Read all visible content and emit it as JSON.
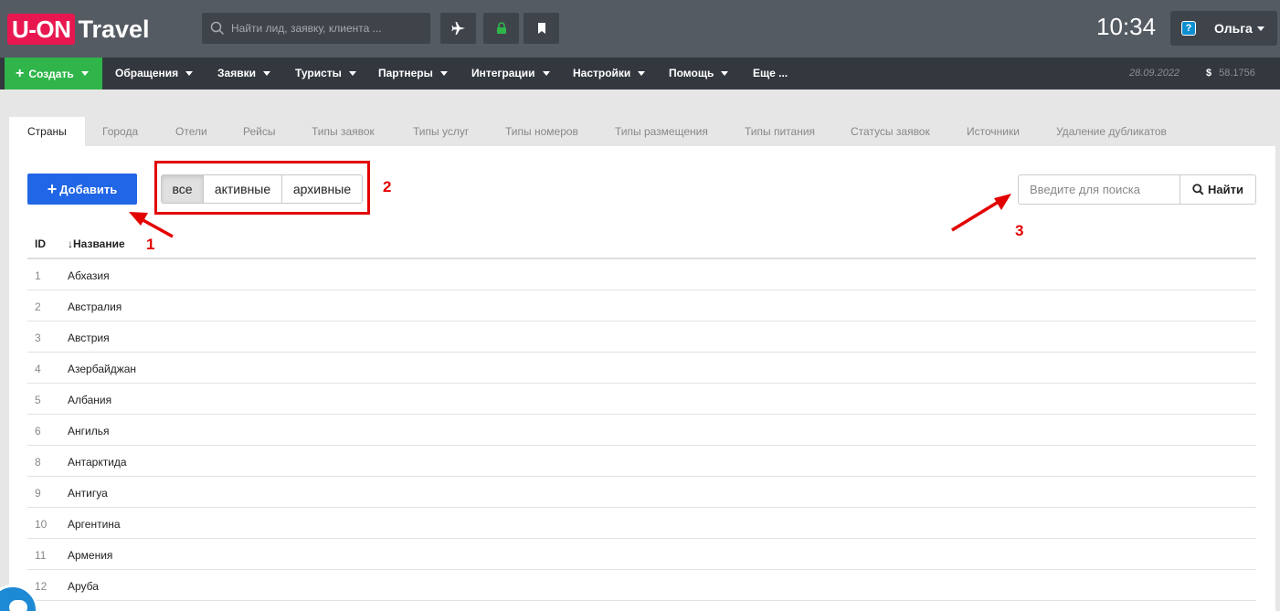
{
  "header": {
    "logo_box": "U-ON",
    "logo_text": "Travel",
    "search_placeholder": "Найти лид, заявку, клиента ...",
    "icons": [
      "plane-icon",
      "lock-icon",
      "bookmark-icon"
    ],
    "clock": "10:34",
    "user": "Ольга",
    "colors": {
      "logo": "#e8174f",
      "lock": "#2fb54a"
    }
  },
  "nav": {
    "create": "Создать",
    "items": [
      "Обращения",
      "Заявки",
      "Туристы",
      "Партнеры",
      "Интеграции",
      "Настройки",
      "Помощь",
      "Еще ..."
    ],
    "date": "28.09.2022",
    "currency": "$",
    "rate": "58.1756"
  },
  "tabs": [
    "Страны",
    "Города",
    "Отели",
    "Рейсы",
    "Типы заявок",
    "Типы услуг",
    "Типы номеров",
    "Типы размещения",
    "Типы питания",
    "Статусы заявок",
    "Источники",
    "Удаление дубликатов"
  ],
  "toolbar": {
    "add_label": "Добавить",
    "filters": [
      "все",
      "активные",
      "архивные"
    ],
    "active_filter": "все",
    "search_placeholder": "Введите для поиска",
    "search_button": "Найти"
  },
  "table": {
    "col_id": "ID",
    "col_name": "Название",
    "rows": [
      {
        "id": "1",
        "name": "Абхазия"
      },
      {
        "id": "2",
        "name": "Австралия"
      },
      {
        "id": "3",
        "name": "Австрия"
      },
      {
        "id": "4",
        "name": "Азербайджан"
      },
      {
        "id": "5",
        "name": "Албания"
      },
      {
        "id": "6",
        "name": "Ангилья"
      },
      {
        "id": "8",
        "name": "Антарктида"
      },
      {
        "id": "9",
        "name": "Антигуа"
      },
      {
        "id": "10",
        "name": "Аргентина"
      },
      {
        "id": "11",
        "name": "Армения"
      },
      {
        "id": "12",
        "name": "Аруба"
      }
    ]
  },
  "annotations": [
    "1",
    "2",
    "3"
  ]
}
